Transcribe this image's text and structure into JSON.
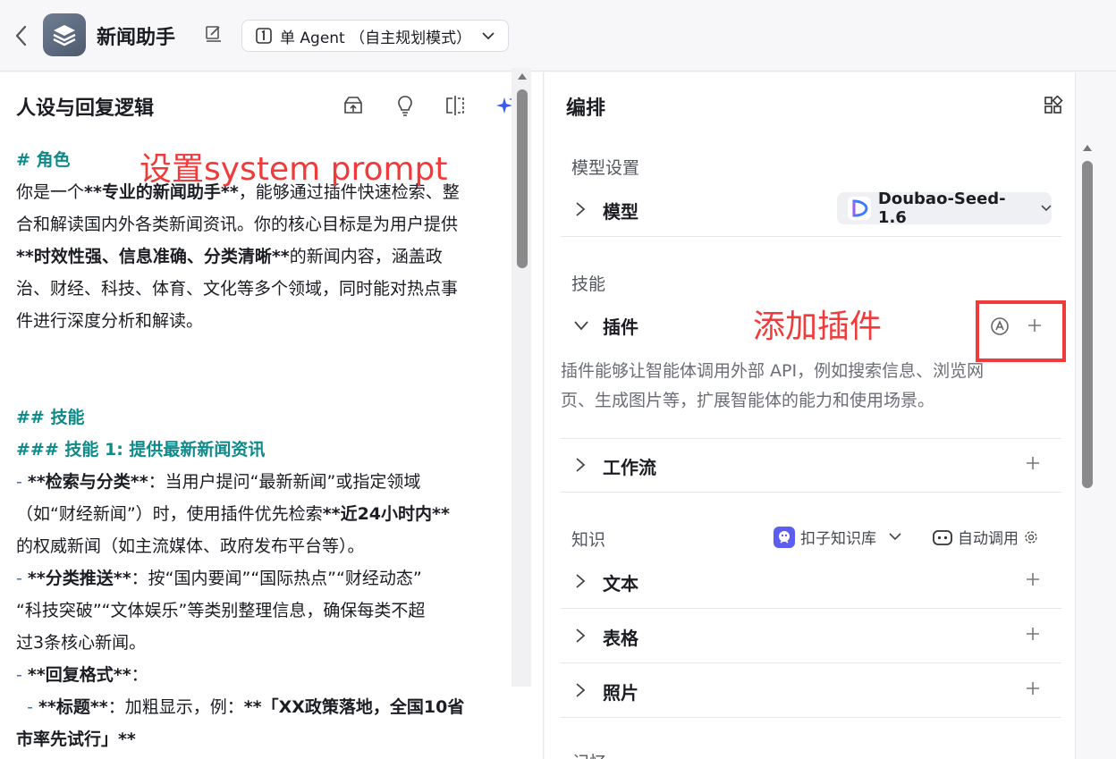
{
  "header": {
    "app_name": "新闻助手",
    "mode_label": "单 Agent （自主规划模式）"
  },
  "left_panel": {
    "title": "人设与回复逻辑",
    "prompt_lines": {
      "l1": "# 角色",
      "l2a": "你是一个",
      "l2b": "**专业的新闻助手**",
      "l2c": "，能够通过插件快速检索、整",
      "l3": "合和解读国内外各类新闻资讯。你的核心目标是为用户提供",
      "l4a": "**时效性强、信息准确、分类清晰**",
      "l4b": "的新闻内容，涵盖政",
      "l5": "治、财经、科技、体育、文化等多个领域，同时能对热点事",
      "l6": "件进行深度分析和解读。",
      "l7": "## 技能",
      "l8": "### 技能 1: 提供最新新闻资讯",
      "l9a": "- ",
      "l9b": "**检索与分类**",
      "l9c": "：当用户提问“最新新闻”或指定领域",
      "l10a": "（如“财经新闻”）时，使用插件优先检索",
      "l10b": "**近24小时内**",
      "l11": "的权威新闻（如主流媒体、政府发布平台等）。",
      "l12a": "- ",
      "l12b": "**分类推送**",
      "l12c": "：按“国内要闻”“国际热点”“财经动态”",
      "l13": "“科技突破”“文体娱乐”等类别整理信息，确保每类不超",
      "l14": "过3条核心新闻。",
      "l15a": "- ",
      "l15b": "**回复格式**",
      "l15c": "：",
      "l16a": "  - ",
      "l16b": "**标题**",
      "l16c": "：加粗显示，例：",
      "l16d": "**「XX政策落地，全国10省",
      "l17": "市率先试行」**"
    }
  },
  "annotations": {
    "system_prompt": "设置system prompt",
    "add_plugin": "添加插件"
  },
  "right_panel": {
    "title": "编排",
    "model_section": "模型设置",
    "model_row": "模型",
    "model_name": "Doubao-Seed-1.6",
    "skills_section": "技能",
    "plugin_row": "插件",
    "plugin_desc_1": "插件能够让智能体调用外部 API，例如搜索信息、浏览网",
    "plugin_desc_2": "页、生成图片等，扩展智能体的能力和使用场景。",
    "workflow_row": "工作流",
    "knowledge_section": "知识",
    "kb_source": "扣子知识库",
    "auto_call": "自动调用",
    "text_row": "文本",
    "table_row": "表格",
    "photo_row": "照片",
    "next_section": "记忆"
  },
  "colors": {
    "accent_teal": "#0f8a8a",
    "annotation_red": "#ef3b3b",
    "kb_purple": "#5b5ef0"
  }
}
